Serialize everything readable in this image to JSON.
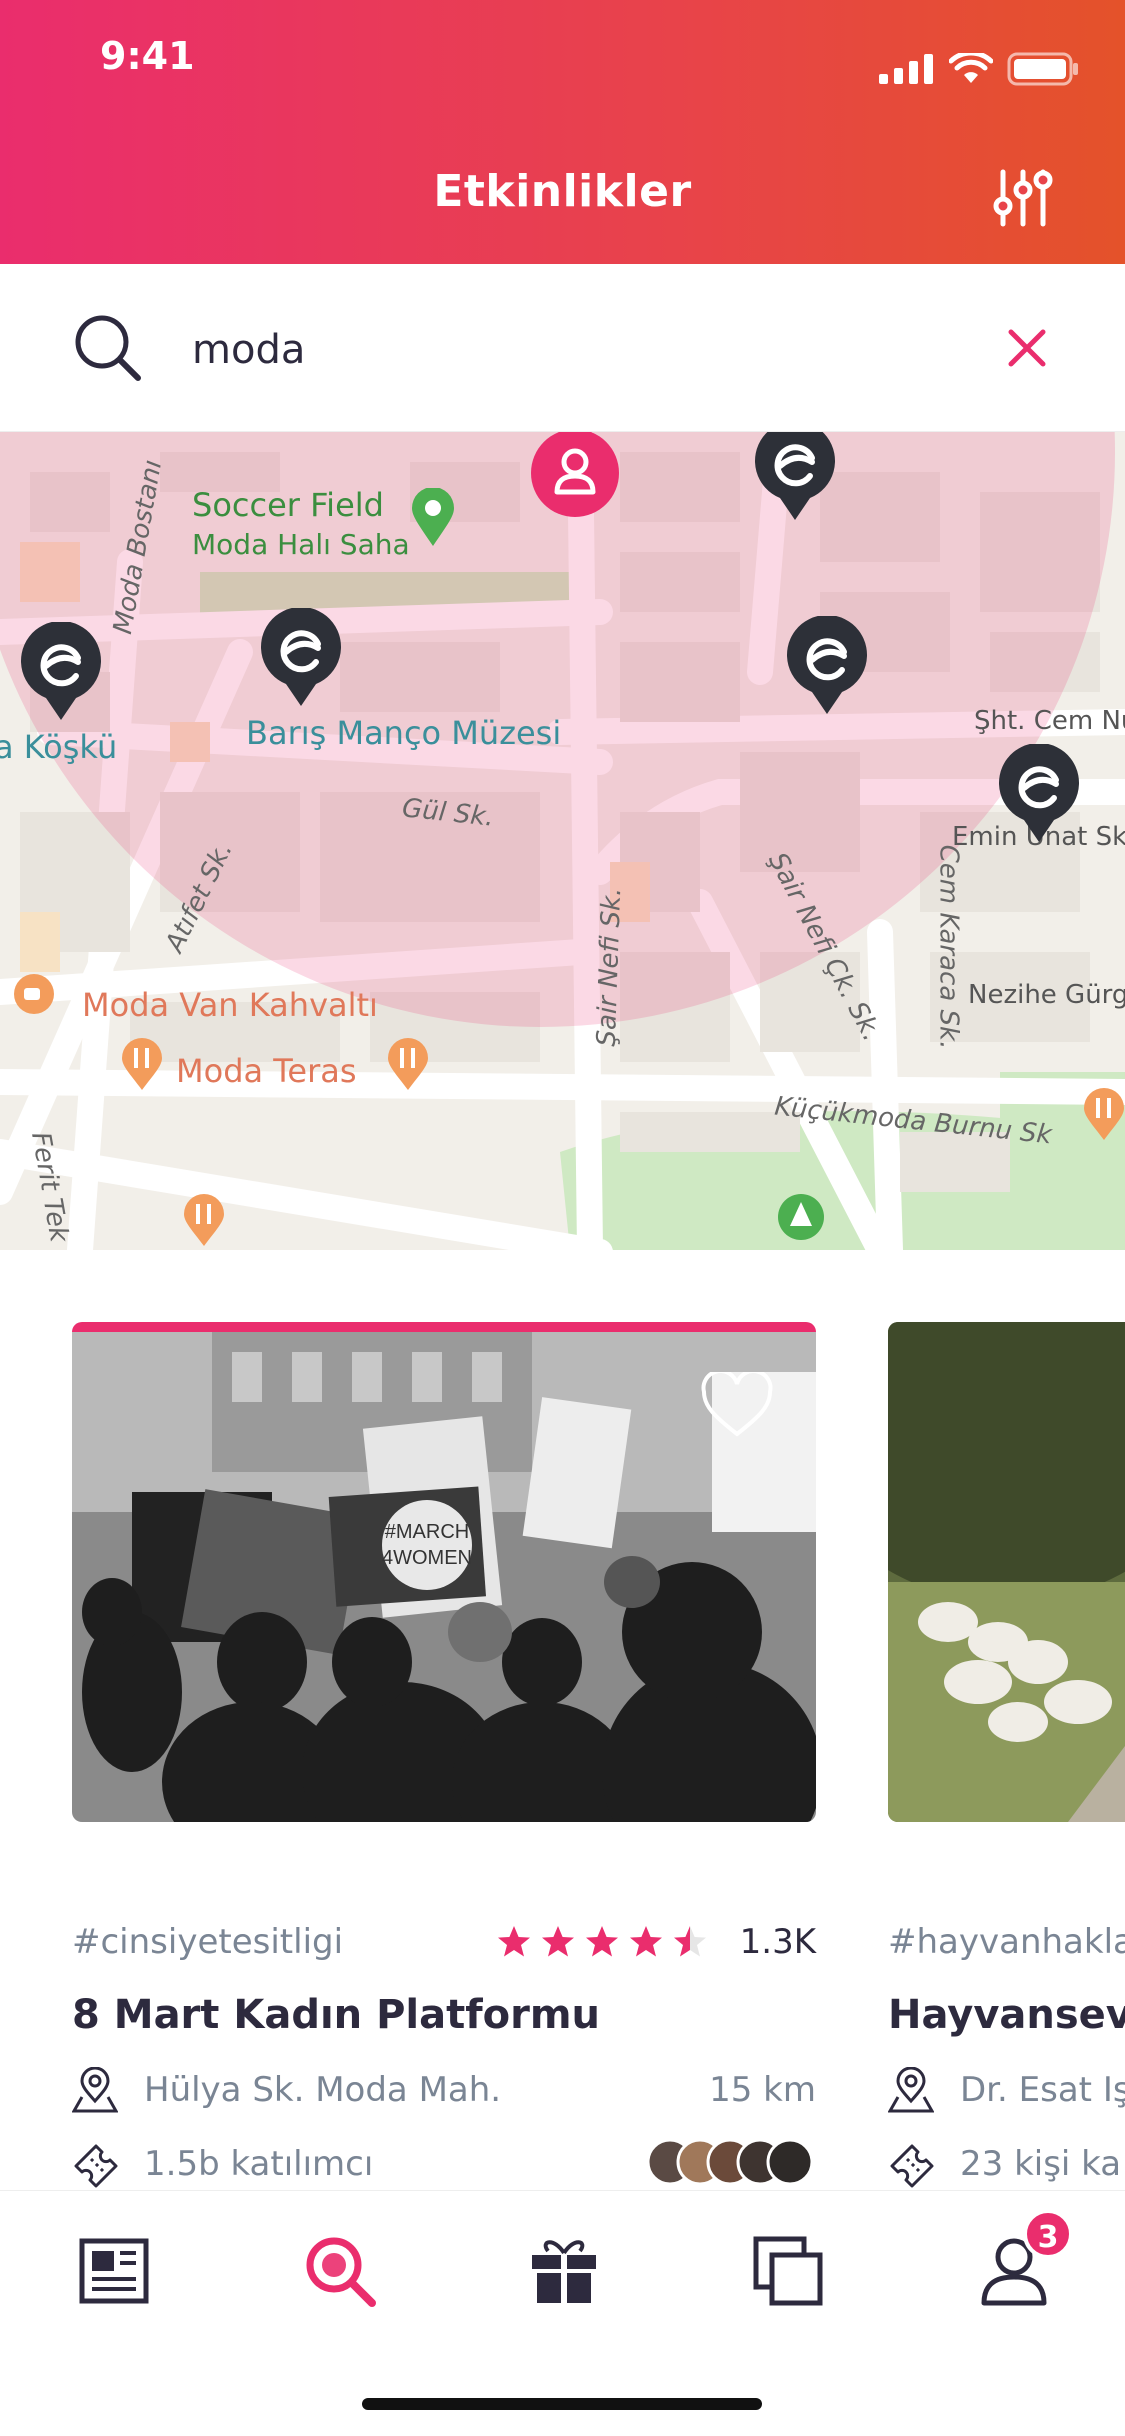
{
  "status_bar": {
    "time": "9:41"
  },
  "header": {
    "title": "Etkinlikler"
  },
  "search": {
    "value": "moda"
  },
  "map": {
    "places": {
      "soccer_field": "Soccer Field",
      "moda_hali_saha": "Moda Halı Saha",
      "baris_manco": "Barış Manço Müzesi",
      "kosku": "a Köşkü",
      "sht_cem": "Şht. Cem Nu",
      "emin_unat": "Emin Unat Sk",
      "moda_van": "Moda Van Kahvaltı",
      "moda_teras": "Moda Teras",
      "nezihe": "Nezihe Gürg",
      "kucukmoda": "Küçükmoda Burnu Sk"
    },
    "streets": {
      "moda_bostani": "Moda Bostanı",
      "gul": "Gül Sk.",
      "atifet": "Atıfet Sk.",
      "sair_nefi": "Şair Nefi Sk.",
      "sair_nefi_cik": "Şair Nefi Çk. Sk.",
      "cem_karaca": "Cem Karaca Sk.",
      "ferit_tek": "Ferit Tek"
    }
  },
  "events": [
    {
      "tag": "#cinsiyetesitligi",
      "rating": 4.5,
      "rating_count": "1.3K",
      "title": "8 Mart Kadın Platformu",
      "address": "Hülya Sk. Moda Mah.",
      "distance": "15 km",
      "participants": "1.5b katılımcı",
      "sign_text": "#MARCH 4WOMEN"
    },
    {
      "tag": "#hayvanhakla",
      "title": "Hayvanseve",
      "address": "Dr. Esat Iş",
      "participants": "23 kişi ka"
    }
  ],
  "tabbar": {
    "profile_badge": "3"
  },
  "colors": {
    "accent": "#ea2d6d",
    "accent_end": "#e4522a",
    "pin": "#2d3038",
    "muted": "#7a8594"
  }
}
